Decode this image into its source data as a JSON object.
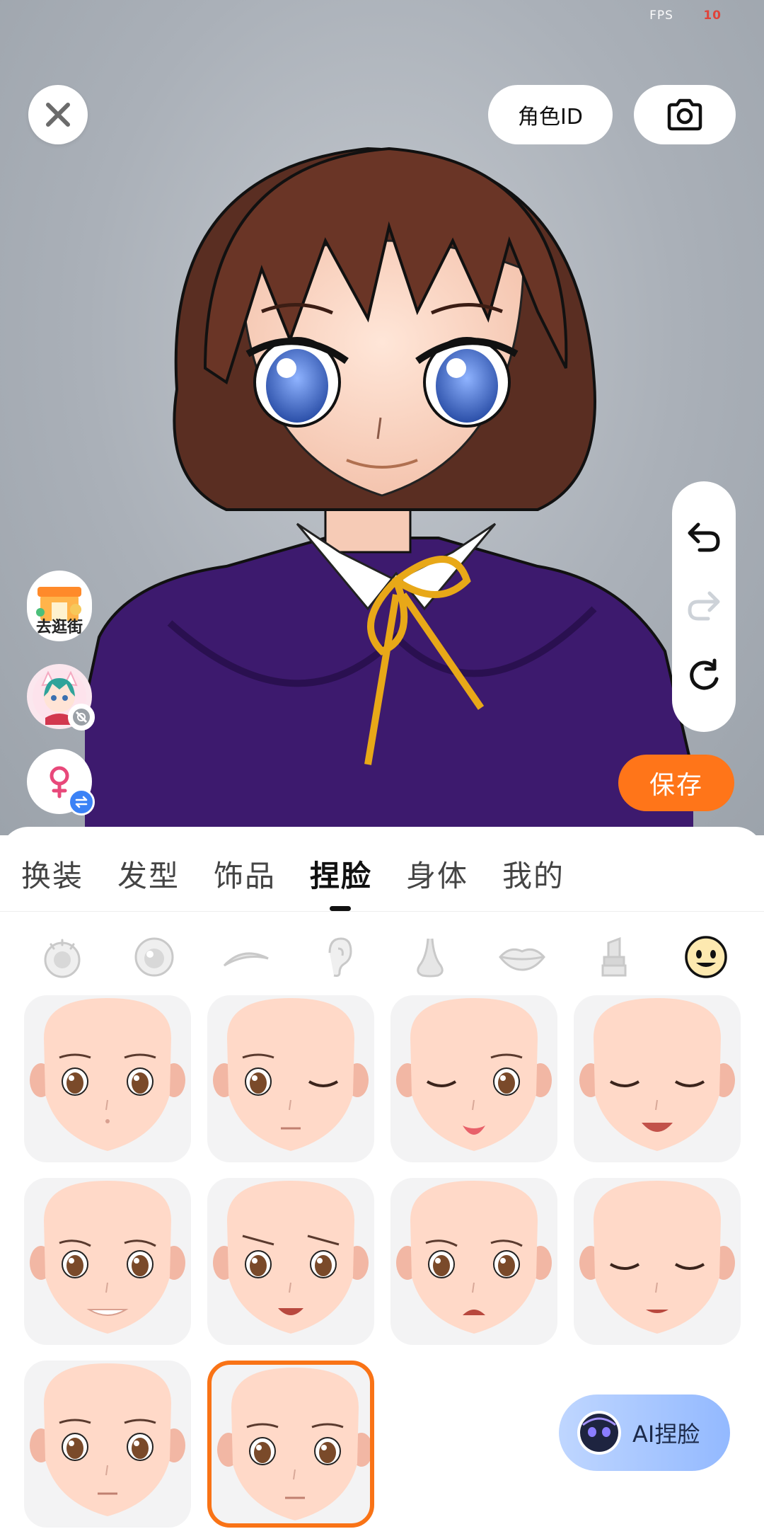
{
  "status": {
    "fps_label": "FPS",
    "fps_value": "10"
  },
  "top_bar": {
    "role_id_label": "角色ID"
  },
  "side": {
    "shop_label": "去逛街"
  },
  "actions": {
    "save_label": "保存"
  },
  "tabs": [
    {
      "label": "换装"
    },
    {
      "label": "发型"
    },
    {
      "label": "饰品"
    },
    {
      "label": "捏脸",
      "active": true
    },
    {
      "label": "身体"
    },
    {
      "label": "我的"
    }
  ],
  "sub_categories": [
    {
      "icon": "eye-style-icon"
    },
    {
      "icon": "pupil-icon"
    },
    {
      "icon": "eyebrow-icon"
    },
    {
      "icon": "ear-icon"
    },
    {
      "icon": "nose-icon"
    },
    {
      "icon": "lips-icon"
    },
    {
      "icon": "lipstick-icon"
    },
    {
      "icon": "expression-icon",
      "active": true
    }
  ],
  "expressions": [
    {
      "id": 1,
      "eyes": "open",
      "mouth": "dot",
      "selected": false
    },
    {
      "id": 2,
      "eyes": "wink",
      "mouth": "line",
      "selected": false
    },
    {
      "id": 3,
      "eyes": "wink-left",
      "mouth": "tongue",
      "selected": false
    },
    {
      "id": 4,
      "eyes": "closed",
      "mouth": "open-smile",
      "selected": false
    },
    {
      "id": 5,
      "eyes": "sad",
      "mouth": "teeth",
      "selected": false
    },
    {
      "id": 6,
      "eyes": "angry",
      "mouth": "open",
      "selected": false
    },
    {
      "id": 7,
      "eyes": "worried",
      "mouth": "frown-open",
      "selected": false
    },
    {
      "id": 8,
      "eyes": "closed",
      "mouth": "small-open",
      "selected": false
    },
    {
      "id": 9,
      "eyes": "open",
      "mouth": "line",
      "selected": false
    },
    {
      "id": 10,
      "eyes": "open",
      "mouth": "line",
      "selected": true
    }
  ],
  "ai_face": {
    "label": "AI捏脸"
  },
  "colors": {
    "accent": "#ff7519",
    "selected_border": "#f97316",
    "ai_button": "#a9c6ff"
  }
}
